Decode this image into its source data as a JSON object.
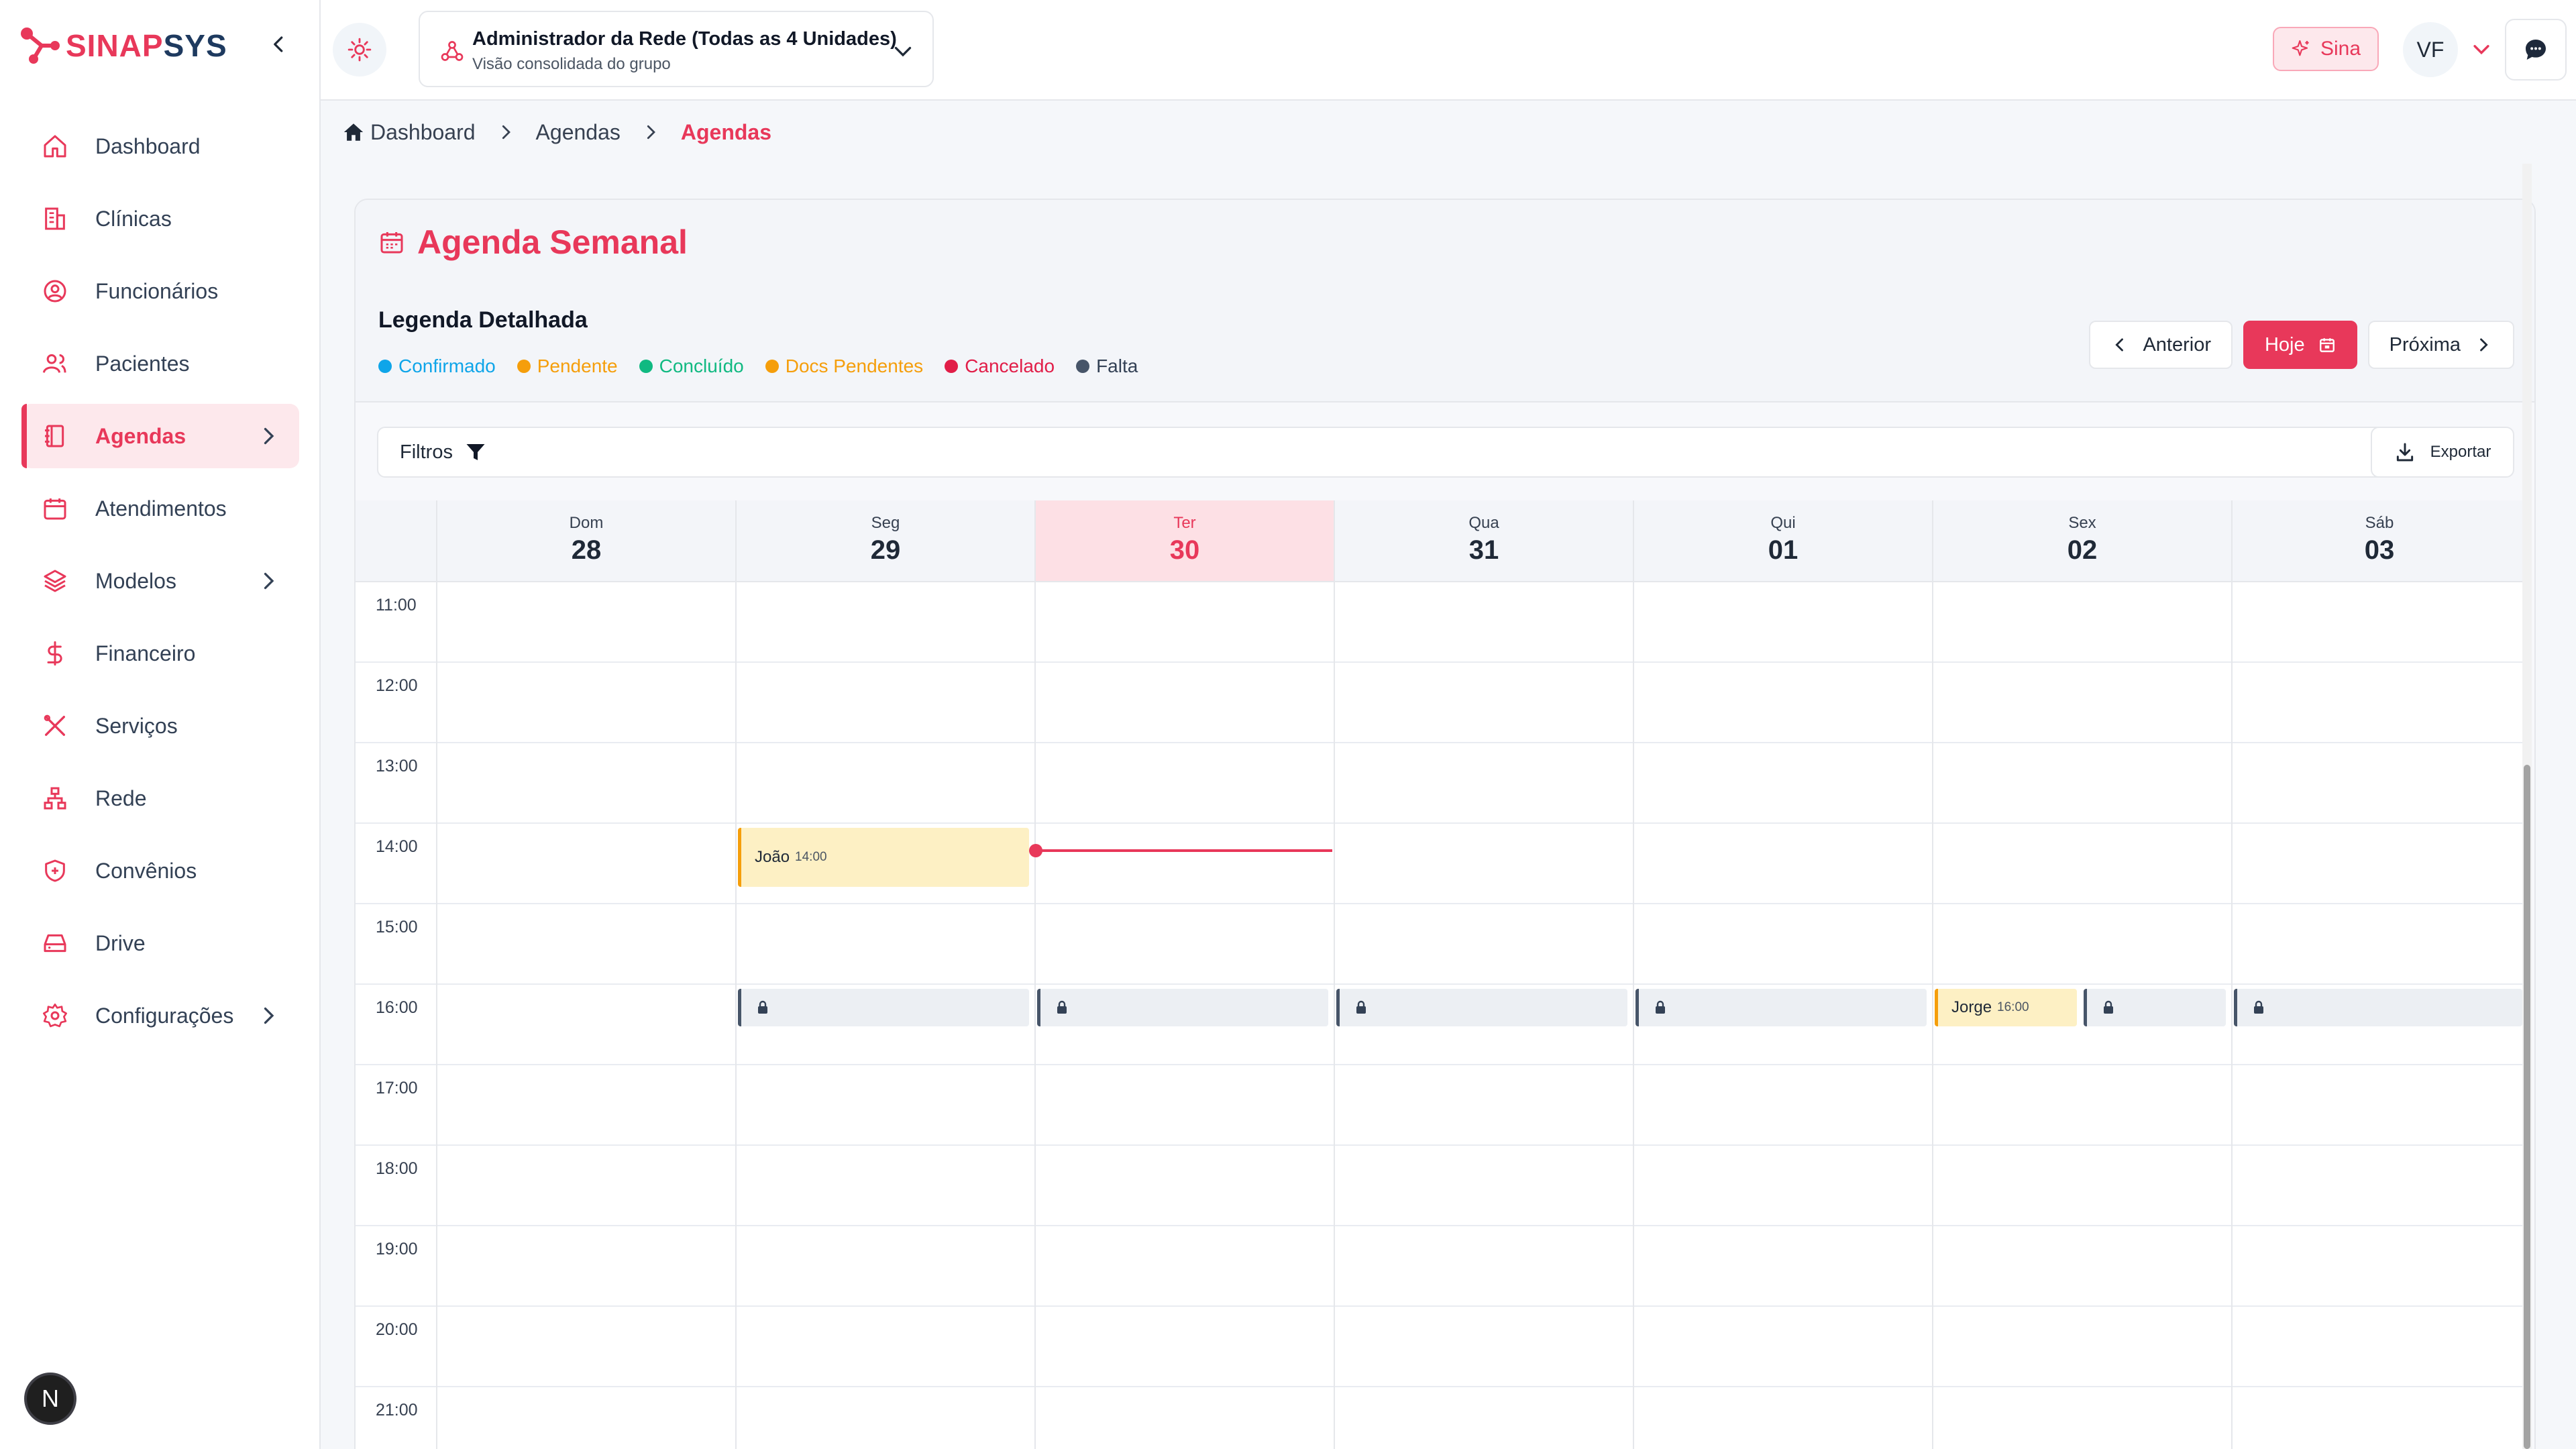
{
  "brand": {
    "name_part1": "SINAP",
    "name_part2": "SYS",
    "primary_color": "#e8385a",
    "dark_color": "#1e3a5f"
  },
  "sidebar": {
    "items": [
      {
        "label": "Dashboard",
        "icon": "home-icon"
      },
      {
        "label": "Clínicas",
        "icon": "building-icon"
      },
      {
        "label": "Funcionários",
        "icon": "user-circle-icon"
      },
      {
        "label": "Pacientes",
        "icon": "users-icon"
      },
      {
        "label": "Agendas",
        "icon": "notebook-icon",
        "active": true,
        "has_children": true
      },
      {
        "label": "Atendimentos",
        "icon": "calendar-icon"
      },
      {
        "label": "Modelos",
        "icon": "layers-icon",
        "has_children": true
      },
      {
        "label": "Financeiro",
        "icon": "dollar-icon"
      },
      {
        "label": "Serviços",
        "icon": "tools-icon"
      },
      {
        "label": "Rede",
        "icon": "network-icon"
      },
      {
        "label": "Convênios",
        "icon": "shield-icon"
      },
      {
        "label": "Drive",
        "icon": "hard-drive-icon"
      },
      {
        "label": "Configurações",
        "icon": "gear-icon",
        "has_children": true
      }
    ],
    "footer_badge": "N"
  },
  "topbar": {
    "unit_title": "Administrador da Rede (Todas as 4 Unidades)",
    "unit_subtitle": "Visão consolidada do grupo",
    "assistant_label": "Sina",
    "avatar_initials": "VF"
  },
  "breadcrumb": {
    "home": "Dashboard",
    "level2": "Agendas",
    "current": "Agendas"
  },
  "agenda": {
    "title": "Agenda Semanal",
    "legend_title": "Legenda Detalhada",
    "legend": [
      {
        "label": "Confirmado",
        "color": "#0ea5e9"
      },
      {
        "label": "Pendente",
        "color": "#f59e0b"
      },
      {
        "label": "Concluído",
        "color": "#10b981"
      },
      {
        "label": "Docs Pendentes",
        "color": "#f59e0b"
      },
      {
        "label": "Cancelado",
        "color": "#e11d48"
      },
      {
        "label": "Falta",
        "color": "#475569"
      }
    ],
    "prev_label": "Anterior",
    "today_label": "Hoje",
    "next_label": "Próxima",
    "filters_label": "Filtros",
    "export_label": "Exportar",
    "days": [
      {
        "name": "Dom",
        "date": "28"
      },
      {
        "name": "Seg",
        "date": "29"
      },
      {
        "name": "Ter",
        "date": "30",
        "today": true
      },
      {
        "name": "Qua",
        "date": "31"
      },
      {
        "name": "Qui",
        "date": "01"
      },
      {
        "name": "Sex",
        "date": "02"
      },
      {
        "name": "Sáb",
        "date": "03"
      }
    ],
    "hours": [
      "11:00",
      "12:00",
      "13:00",
      "14:00",
      "15:00",
      "16:00",
      "17:00",
      "18:00",
      "19:00",
      "20:00",
      "21:00"
    ],
    "appointments": [
      {
        "name": "João",
        "time": "14:00",
        "day": "Seg"
      },
      {
        "name": "Jorge",
        "time": "16:00",
        "day": "Sex"
      }
    ]
  }
}
